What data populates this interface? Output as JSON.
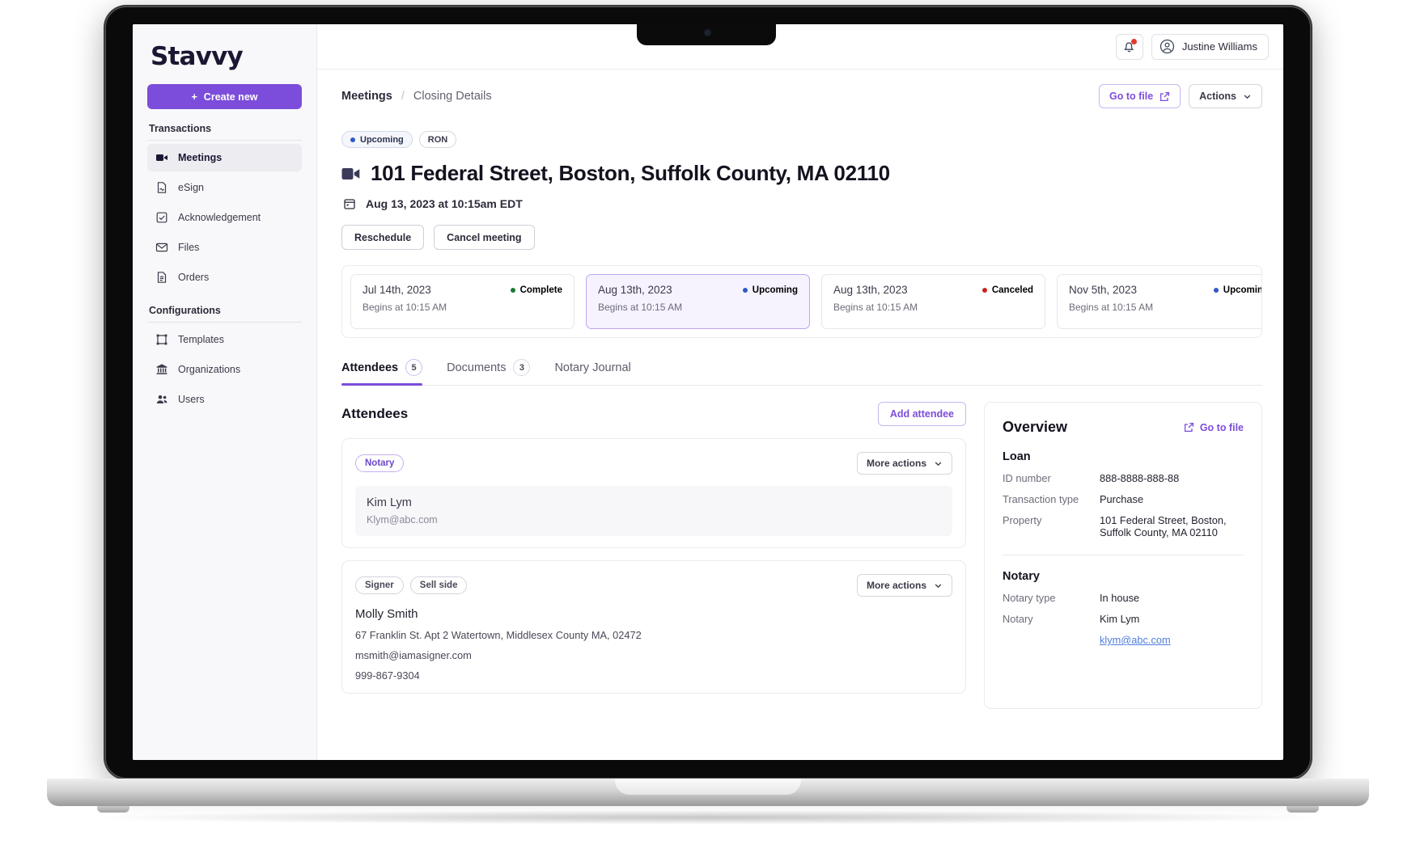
{
  "brand": {
    "name": "Stavvy"
  },
  "sidebar": {
    "create_button": "Create new",
    "sections": [
      {
        "title": "Transactions",
        "items": [
          {
            "label": "Meetings",
            "icon": "video-camera-icon",
            "active": true
          },
          {
            "label": "eSign",
            "icon": "signature-document-icon",
            "active": false
          },
          {
            "label": "Acknowledgement",
            "icon": "checkbox-icon",
            "active": false
          },
          {
            "label": "Files",
            "icon": "envelope-icon",
            "active": false
          },
          {
            "label": "Orders",
            "icon": "document-icon",
            "active": false
          }
        ]
      },
      {
        "title": "Configurations",
        "items": [
          {
            "label": "Templates",
            "icon": "template-frame-icon",
            "active": false
          },
          {
            "label": "Organizations",
            "icon": "bank-icon",
            "active": false
          },
          {
            "label": "Users",
            "icon": "users-icon",
            "active": false
          }
        ]
      }
    ]
  },
  "topbar": {
    "notification_icon": "bell-icon",
    "has_notification": true,
    "user_name": "Justine Williams",
    "user_icon": "user-circle-icon"
  },
  "breadcrumb": {
    "parent": "Meetings",
    "separator": "/",
    "current": "Closing Details"
  },
  "header_actions": {
    "go_to_file": "Go to file",
    "actions": "Actions"
  },
  "meeting": {
    "status_badge": "Upcoming",
    "type_badge": "RON",
    "title": "101 Federal Street, Boston, Suffolk County, MA 02110",
    "datetime": "Aug 13, 2023 at 10:15am EDT",
    "reschedule_button": "Reschedule",
    "cancel_button": "Cancel meeting"
  },
  "occurrences": [
    {
      "date": "Jul 14th, 2023",
      "begins": "Begins at 10:15 AM",
      "status": "Complete",
      "color": "#1d7a34",
      "selected": false
    },
    {
      "date": "Aug 13th, 2023",
      "begins": "Begins at 10:15 AM",
      "status": "Upcoming",
      "color": "#2f58c4",
      "selected": true
    },
    {
      "date": "Aug 13th, 2023",
      "begins": "Begins at 10:15 AM",
      "status": "Canceled",
      "color": "#c7261c",
      "selected": false
    },
    {
      "date": "Nov 5th, 2023",
      "begins": "Begins at 10:15 AM",
      "status": "Upcoming",
      "color": "#2f58c4",
      "selected": false
    }
  ],
  "tabs": [
    {
      "label": "Attendees",
      "count": "5",
      "active": true
    },
    {
      "label": "Documents",
      "count": "3",
      "active": false
    },
    {
      "label": "Notary Journal",
      "count": "",
      "active": false
    }
  ],
  "attendees_section": {
    "title": "Attendees",
    "add_button": "Add attendee",
    "more_actions": "More actions",
    "cards": [
      {
        "tags": [
          {
            "text": "Notary",
            "style": "purple"
          }
        ],
        "name": "Kim Lym",
        "email": "Klym@abc.com",
        "address": "",
        "phone": "",
        "grey": true
      },
      {
        "tags": [
          {
            "text": "Signer",
            "style": "grey"
          },
          {
            "text": "Sell side",
            "style": "grey"
          }
        ],
        "name": "Molly Smith",
        "address": "67 Franklin St. Apt 2  Watertown,  Middlesex County  MA, 02472",
        "email": "msmith@iamasigner.com",
        "phone": "999-867-9304",
        "grey": false
      }
    ]
  },
  "overview": {
    "title": "Overview",
    "go_to_file": "Go to file",
    "loan": {
      "heading": "Loan",
      "rows": [
        {
          "key": "ID number",
          "value": "888-8888-888-88"
        },
        {
          "key": "Transaction type",
          "value": "Purchase"
        },
        {
          "key": "Property",
          "value": "101 Federal Street, Boston, Suffolk County, MA 02110"
        }
      ]
    },
    "notary": {
      "heading": "Notary",
      "rows": [
        {
          "key": "Notary type",
          "value": "In house"
        },
        {
          "key": "Notary",
          "value": "Kim Lym"
        }
      ],
      "email_link": "klym@abc.com"
    }
  },
  "colors": {
    "brand_purple": "#7c4ddb",
    "complete_green": "#1d7a34",
    "upcoming_blue": "#2f58c4",
    "canceled_red": "#c7261c",
    "link_blue": "#4f7ddb"
  }
}
